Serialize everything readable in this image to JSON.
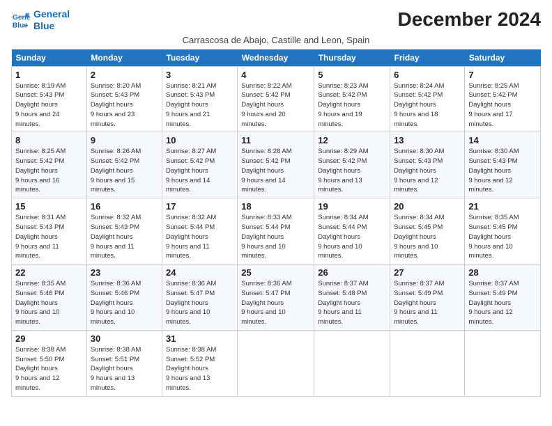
{
  "logo": {
    "line1": "General",
    "line2": "Blue"
  },
  "title": "December 2024",
  "subtitle": "Carrascosa de Abajo, Castille and Leon, Spain",
  "days_header": [
    "Sunday",
    "Monday",
    "Tuesday",
    "Wednesday",
    "Thursday",
    "Friday",
    "Saturday"
  ],
  "weeks": [
    [
      {
        "num": "1",
        "sunrise": "8:19 AM",
        "sunset": "5:43 PM",
        "daylight": "9 hours and 24 minutes."
      },
      {
        "num": "2",
        "sunrise": "8:20 AM",
        "sunset": "5:43 PM",
        "daylight": "9 hours and 23 minutes."
      },
      {
        "num": "3",
        "sunrise": "8:21 AM",
        "sunset": "5:43 PM",
        "daylight": "9 hours and 21 minutes."
      },
      {
        "num": "4",
        "sunrise": "8:22 AM",
        "sunset": "5:42 PM",
        "daylight": "9 hours and 20 minutes."
      },
      {
        "num": "5",
        "sunrise": "8:23 AM",
        "sunset": "5:42 PM",
        "daylight": "9 hours and 19 minutes."
      },
      {
        "num": "6",
        "sunrise": "8:24 AM",
        "sunset": "5:42 PM",
        "daylight": "9 hours and 18 minutes."
      },
      {
        "num": "7",
        "sunrise": "8:25 AM",
        "sunset": "5:42 PM",
        "daylight": "9 hours and 17 minutes."
      }
    ],
    [
      {
        "num": "8",
        "sunrise": "8:25 AM",
        "sunset": "5:42 PM",
        "daylight": "9 hours and 16 minutes."
      },
      {
        "num": "9",
        "sunrise": "8:26 AM",
        "sunset": "5:42 PM",
        "daylight": "9 hours and 15 minutes."
      },
      {
        "num": "10",
        "sunrise": "8:27 AM",
        "sunset": "5:42 PM",
        "daylight": "9 hours and 14 minutes."
      },
      {
        "num": "11",
        "sunrise": "8:28 AM",
        "sunset": "5:42 PM",
        "daylight": "9 hours and 14 minutes."
      },
      {
        "num": "12",
        "sunrise": "8:29 AM",
        "sunset": "5:42 PM",
        "daylight": "9 hours and 13 minutes."
      },
      {
        "num": "13",
        "sunrise": "8:30 AM",
        "sunset": "5:43 PM",
        "daylight": "9 hours and 12 minutes."
      },
      {
        "num": "14",
        "sunrise": "8:30 AM",
        "sunset": "5:43 PM",
        "daylight": "9 hours and 12 minutes."
      }
    ],
    [
      {
        "num": "15",
        "sunrise": "8:31 AM",
        "sunset": "5:43 PM",
        "daylight": "9 hours and 11 minutes."
      },
      {
        "num": "16",
        "sunrise": "8:32 AM",
        "sunset": "5:43 PM",
        "daylight": "9 hours and 11 minutes."
      },
      {
        "num": "17",
        "sunrise": "8:32 AM",
        "sunset": "5:44 PM",
        "daylight": "9 hours and 11 minutes."
      },
      {
        "num": "18",
        "sunrise": "8:33 AM",
        "sunset": "5:44 PM",
        "daylight": "9 hours and 10 minutes."
      },
      {
        "num": "19",
        "sunrise": "8:34 AM",
        "sunset": "5:44 PM",
        "daylight": "9 hours and 10 minutes."
      },
      {
        "num": "20",
        "sunrise": "8:34 AM",
        "sunset": "5:45 PM",
        "daylight": "9 hours and 10 minutes."
      },
      {
        "num": "21",
        "sunrise": "8:35 AM",
        "sunset": "5:45 PM",
        "daylight": "9 hours and 10 minutes."
      }
    ],
    [
      {
        "num": "22",
        "sunrise": "8:35 AM",
        "sunset": "5:46 PM",
        "daylight": "9 hours and 10 minutes."
      },
      {
        "num": "23",
        "sunrise": "8:36 AM",
        "sunset": "5:46 PM",
        "daylight": "9 hours and 10 minutes."
      },
      {
        "num": "24",
        "sunrise": "8:36 AM",
        "sunset": "5:47 PM",
        "daylight": "9 hours and 10 minutes."
      },
      {
        "num": "25",
        "sunrise": "8:36 AM",
        "sunset": "5:47 PM",
        "daylight": "9 hours and 10 minutes."
      },
      {
        "num": "26",
        "sunrise": "8:37 AM",
        "sunset": "5:48 PM",
        "daylight": "9 hours and 11 minutes."
      },
      {
        "num": "27",
        "sunrise": "8:37 AM",
        "sunset": "5:49 PM",
        "daylight": "9 hours and 11 minutes."
      },
      {
        "num": "28",
        "sunrise": "8:37 AM",
        "sunset": "5:49 PM",
        "daylight": "9 hours and 12 minutes."
      }
    ],
    [
      {
        "num": "29",
        "sunrise": "8:38 AM",
        "sunset": "5:50 PM",
        "daylight": "9 hours and 12 minutes."
      },
      {
        "num": "30",
        "sunrise": "8:38 AM",
        "sunset": "5:51 PM",
        "daylight": "9 hours and 13 minutes."
      },
      {
        "num": "31",
        "sunrise": "8:38 AM",
        "sunset": "5:52 PM",
        "daylight": "9 hours and 13 minutes."
      },
      null,
      null,
      null,
      null
    ]
  ]
}
